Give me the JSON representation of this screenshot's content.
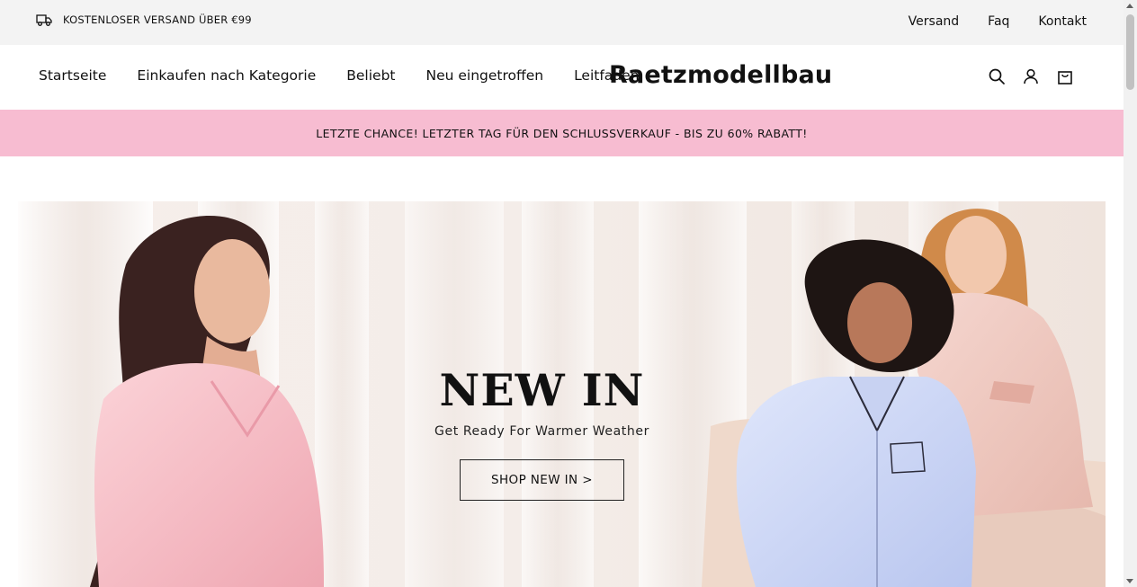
{
  "topbar": {
    "shipping_icon": "truck-icon",
    "shipping_text": "KOSTENLOSER VERSAND ÜBER €99",
    "links": [
      "Versand",
      "Faq",
      "Kontakt"
    ]
  },
  "header": {
    "nav": [
      "Startseite",
      "Einkaufen nach Kategorie",
      "Beliebt",
      "Neu eingetroffen",
      "Leitfaden"
    ],
    "logo": "Raetzmodellbau",
    "icons": [
      "search-icon",
      "account-icon",
      "cart-icon"
    ]
  },
  "promo": {
    "text": "LETZTE CHANCE! LETZTER TAG FÜR DEN SCHLUSSVERKAUF - BIS ZU 60% RABATT!",
    "background": "#f7bcd1"
  },
  "hero": {
    "title": "NEW IN",
    "subtitle": "Get Ready For Warmer Weather",
    "cta_label": "SHOP NEW IN >"
  }
}
